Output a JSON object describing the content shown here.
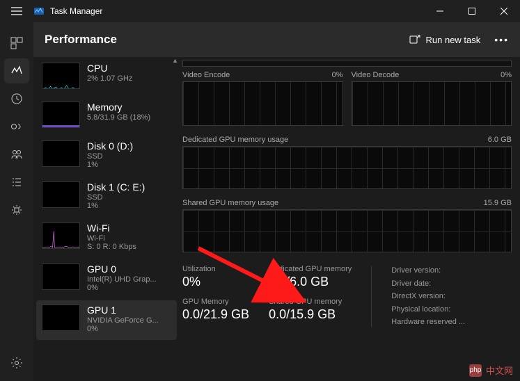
{
  "app": {
    "title": "Task Manager"
  },
  "header": {
    "title": "Performance",
    "runTask": "Run new task"
  },
  "sidebar": {
    "items": [
      {
        "name": "CPU",
        "sub1": "2%  1.07 GHz",
        "sub2": ""
      },
      {
        "name": "Memory",
        "sub1": "5.8/31.9 GB (18%)",
        "sub2": ""
      },
      {
        "name": "Disk 0 (D:)",
        "sub1": "SSD",
        "sub2": "1%"
      },
      {
        "name": "Disk 1 (C: E:)",
        "sub1": "SSD",
        "sub2": "1%"
      },
      {
        "name": "Wi-Fi",
        "sub1": "Wi-Fi",
        "sub2": "S: 0 R: 0 Kbps"
      },
      {
        "name": "GPU 0",
        "sub1": "Intel(R) UHD Grap...",
        "sub2": "0%"
      },
      {
        "name": "GPU 1",
        "sub1": "NVIDIA GeForce G...",
        "sub2": "0%"
      }
    ]
  },
  "details": {
    "videoEncode": {
      "label": "Video Encode",
      "pct": "0%"
    },
    "videoDecode": {
      "label": "Video Decode",
      "pct": "0%"
    },
    "dedicatedUsage": {
      "label": "Dedicated GPU memory usage",
      "max": "6.0 GB"
    },
    "sharedUsage": {
      "label": "Shared GPU memory usage",
      "max": "15.9 GB"
    },
    "stats": {
      "utilization": {
        "label": "Utilization",
        "value": "0%"
      },
      "gpuMemory": {
        "label": "GPU Memory",
        "value": "0.0/21.9 GB"
      },
      "dedicated": {
        "label": "Dedicated GPU memory",
        "value": "0.0/6.0 GB"
      },
      "shared": {
        "label": "Shared GPU memory",
        "value": "0.0/15.9 GB"
      },
      "info": {
        "driverVersion": "Driver version:",
        "driverDate": "Driver date:",
        "directx": "DirectX version:",
        "location": "Physical location:",
        "reserved": "Hardware reserved ..."
      }
    }
  },
  "watermark": {
    "text": "中文网",
    "prefix": "php"
  }
}
